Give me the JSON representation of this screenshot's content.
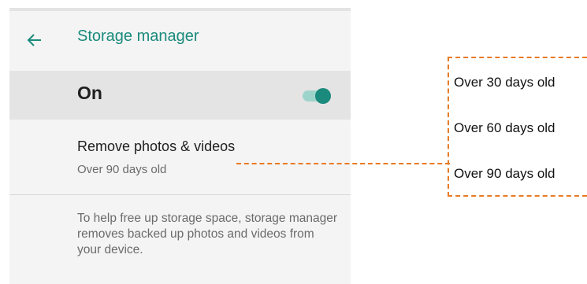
{
  "appbar": {
    "title": "Storage manager",
    "back_icon": "arrow-back-icon"
  },
  "master_toggle": {
    "label": "On",
    "state": true,
    "accent": "#1a8a7c"
  },
  "setting": {
    "title": "Remove photos & videos",
    "value": "Over 90 days old"
  },
  "footer": {
    "text": "To help free up storage space, storage manager removes backed up photos and videos from your device."
  },
  "options_popup": {
    "items": [
      "Over 30 days old",
      "Over 60 days old",
      "Over 90 days old"
    ],
    "highlight_color": "#e87a22"
  }
}
